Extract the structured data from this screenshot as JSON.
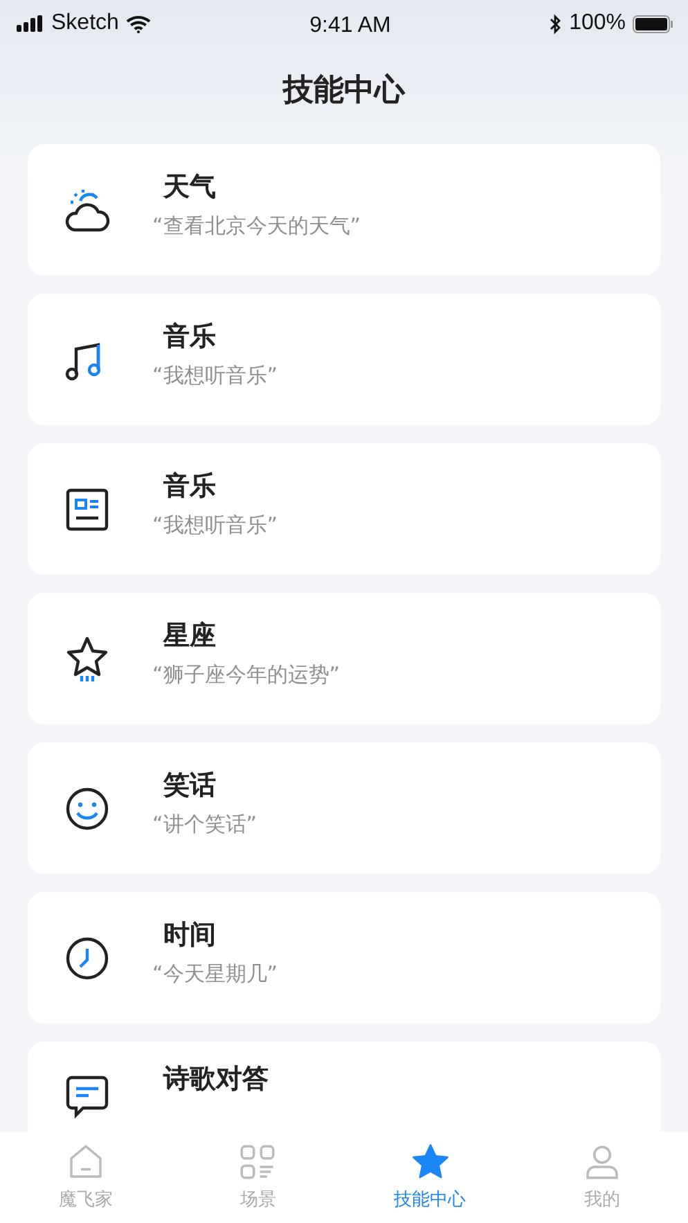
{
  "status_bar": {
    "carrier": "Sketch",
    "time": "9:41 AM",
    "battery": "100%"
  },
  "title": "技能中心",
  "skills": [
    {
      "name": "天气",
      "example": "“查看北京今天的天气”"
    },
    {
      "name": "音乐",
      "example": "“我想听音乐”"
    },
    {
      "name": "音乐",
      "example": "“我想听音乐”"
    },
    {
      "name": "星座",
      "example": "“狮子座今年的运势”"
    },
    {
      "name": "笑话",
      "example": "“讲个笑话”"
    },
    {
      "name": "时间",
      "example": "“今天星期几”"
    },
    {
      "name": "诗歌对答"
    }
  ],
  "tabs": [
    {
      "label": "魔飞家",
      "selected": false
    },
    {
      "label": "场景",
      "selected": false
    },
    {
      "label": "技能中心",
      "selected": true
    },
    {
      "label": "我的",
      "selected": false
    }
  ]
}
